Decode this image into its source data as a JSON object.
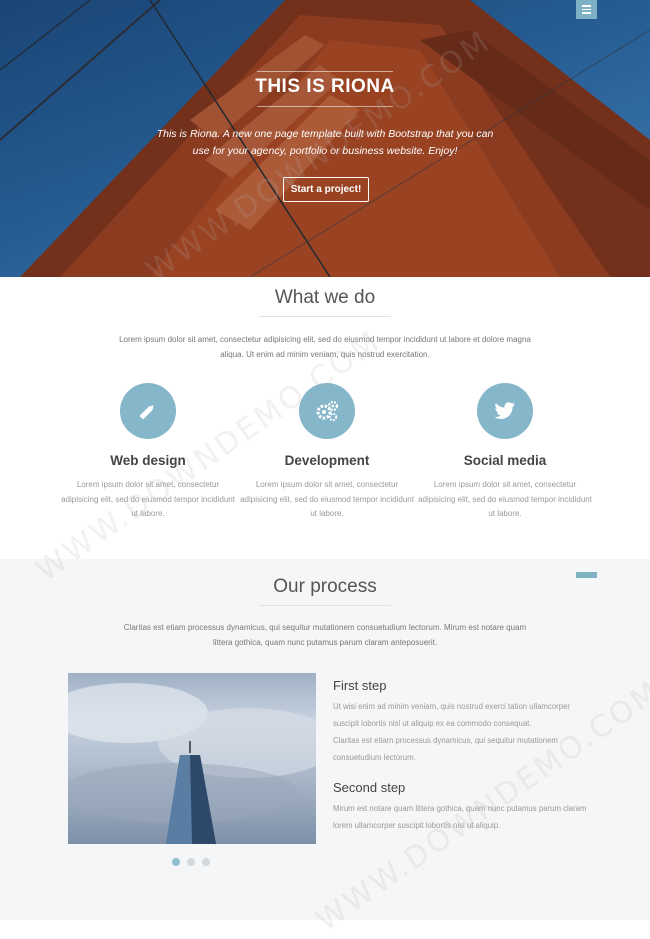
{
  "hero": {
    "menu_icon": "hamburger-icon",
    "title": "THIS IS RIONA",
    "subtitle": "This is Riona. A new one page template built with Bootstrap that you can use for your agency, portfolio or business website. Enjoy!",
    "cta_label": "Start a project!"
  },
  "what_we_do": {
    "title": "What we do",
    "intro": "Lorem ipsum dolor sit amet, consectetur adipisicing elit, sed do eiusmod tempor incididunt ut labore et dolore magna aliqua. Ut enim ad minim veniam, quis nostrud exercitation.",
    "services": [
      {
        "icon": "pencil-icon",
        "title": "Web design",
        "text": "Lorem ipsum dolor sit amet, consectetur adipisicing elit, sed do eiusmod tempor incididunt ut labore."
      },
      {
        "icon": "gears-icon",
        "title": "Development",
        "text": "Lorem ipsum dolor sit amet, consectetur adipisicing elit, sed do eiusmod tempor incididunt ut labore."
      },
      {
        "icon": "twitter-icon",
        "title": "Social media",
        "text": "Lorem ipsum dolor sit amet, consectetur adipisicing elit, sed do eiusmod tempor incididunt ut labore."
      }
    ],
    "accent_color": "#85b6c9"
  },
  "our_process": {
    "title": "Our process",
    "intro": "Claritas est etiam processus dynamicus, qui sequitur mutationem consuetudium lectorum. Mirum est notare quam littera gothica, quam nunc putamus parum claram anteposuerit.",
    "steps": [
      {
        "title": "First step",
        "paragraphs": [
          "Ut wisi enim ad minim veniam, quis nostrud exerci tation ullamcorper suscipit lobortis nisl ut aliquip ex ea commodo consequat.",
          "Claritas est etiam processus dynamicus, qui sequitur mutationem consuetudium lectorum."
        ]
      },
      {
        "title": "Second step",
        "paragraphs": [
          "Mirum est notare quam littera gothica, quam nunc putamus parum claram lorem ullamcorper suscipit lobortis nisl ut aliquip."
        ]
      }
    ],
    "slider_count": 3,
    "slider_active": 1
  },
  "watermark": "WWW.DOWNDEMO.COM"
}
